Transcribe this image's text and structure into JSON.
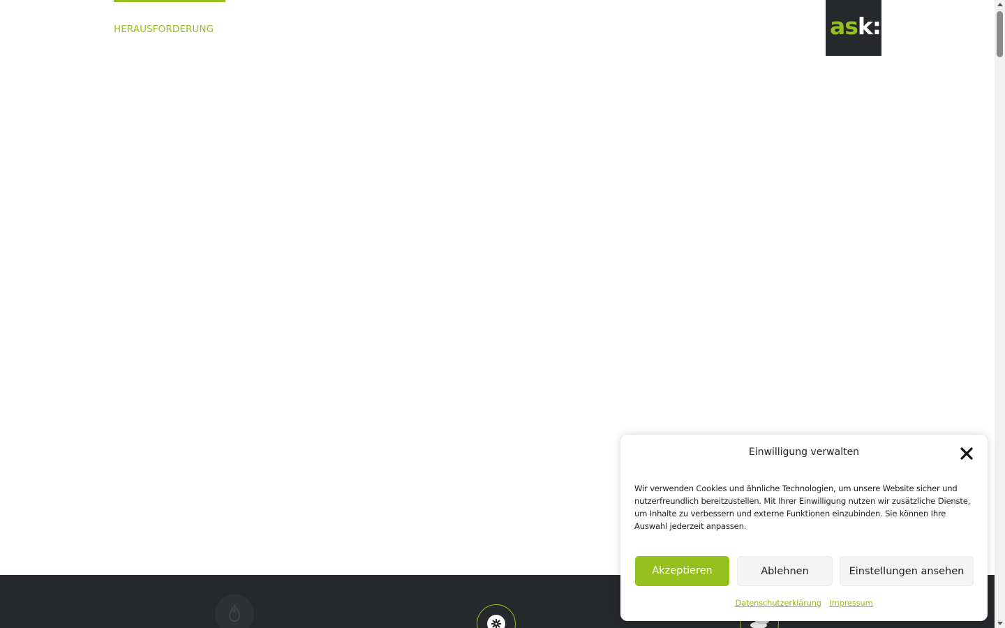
{
  "colors": {
    "accent": "#95c11f",
    "dark": "#26282b",
    "text": "#222222"
  },
  "nav": {
    "active_tab_label": "HERAUSFORDERUNG"
  },
  "logo": {
    "part_green": "as",
    "part_white": "k:"
  },
  "feature_icons": [
    {
      "icon": "flame-icon"
    },
    {
      "icon": "gear-icon"
    },
    {
      "icon": "coins-icon"
    }
  ],
  "consent": {
    "title": "Einwilligung verwalten",
    "body": "Wir verwenden Cookies und ähnliche Technologien, um unsere Website sicher und nutzerfreundlich bereitzustellen. Mit Ihrer Einwilligung nutzen wir zusätzliche Dienste, um Inhalte zu verbessern und externe Funktionen einzubinden. Sie können Ihre Auswahl jederzeit anpassen.",
    "accept_label": "Akzeptieren",
    "deny_label": "Ablehnen",
    "settings_label": "Einstellungen ansehen",
    "privacy_link": "Datenschutzerklärung",
    "imprint_link": "Impressum"
  }
}
